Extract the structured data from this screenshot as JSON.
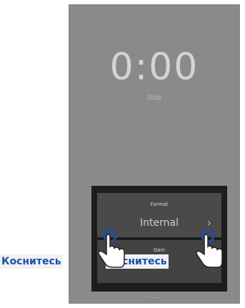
{
  "status_bar": {
    "text": "· · ·  ·"
  },
  "recorder": {
    "time": "0:00",
    "state": "Stop"
  },
  "settings_dialog": {
    "format_title": "Format",
    "format_value": "Internal",
    "gain_title": "Gain"
  },
  "callouts": {
    "left_label": "Коснитесь",
    "right_label": "Коснитесь"
  },
  "icons": {
    "chevron": "chevron-right-icon",
    "hand": "tap-hand-icon"
  },
  "colors": {
    "screen": "#8a8a8a",
    "dialog": "#1d1d1d",
    "callout_text": "#1a4fb0",
    "touch_ring": "#1a4fb0"
  }
}
